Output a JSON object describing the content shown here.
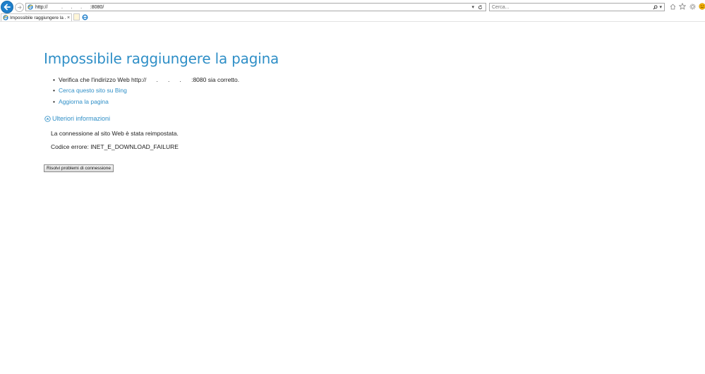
{
  "browser": {
    "address_url": "http://          .      .      .      :8080/",
    "search_placeholder": "Cerca...",
    "tab_title": "Impossibile raggiungere la ...",
    "tab_close": "×"
  },
  "error": {
    "title": "Impossibile raggiungere la pagina",
    "suggestions": {
      "check_prefix": "Verifica che l'indirizzo Web http://",
      "check_host": "      .      .      .      ",
      "check_suffix": ":8080 sia corretto.",
      "bing": "Cerca questo sito su Bing",
      "refresh": "Aggiorna la pagina"
    },
    "more_info": "Ulteriori informazioni",
    "detail_text": "La connessione al sito Web è stata reimpostata.",
    "error_code": "Codice errore: INET_E_DOWNLOAD_FAILURE",
    "fix_button": "Risolvi problemi di connessione"
  },
  "colors": {
    "link": "#2f8fc7",
    "back_button": "#1e7fcb",
    "smiley": "#f3b000"
  },
  "icons": [
    "back-arrow-icon",
    "forward-arrow-icon",
    "ie-icon",
    "dropdown-icon",
    "refresh-icon",
    "search-icon",
    "home-icon",
    "favorites-star-icon",
    "settings-gear-icon",
    "feedback-smiley-icon",
    "new-tab-icon",
    "edge-icon",
    "chevron-up-circle-icon"
  ]
}
